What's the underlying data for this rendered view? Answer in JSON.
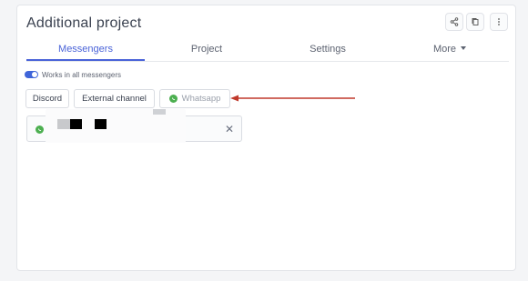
{
  "card": {
    "title": "Additional project"
  },
  "toolbar": {
    "icons": [
      "share-icon",
      "copy-icon",
      "more-vertical-icon"
    ]
  },
  "tabs": [
    {
      "label": "Messengers",
      "active": true
    },
    {
      "label": "Project",
      "active": false
    },
    {
      "label": "Settings",
      "active": false
    },
    {
      "label": "More",
      "active": false,
      "dropdown": true
    }
  ],
  "toggle": {
    "label": "Works in all messengers",
    "on": true
  },
  "channels": [
    {
      "label": "Discord"
    },
    {
      "label": "External channel"
    },
    {
      "label": "Whatsapp",
      "icon": "whatsapp-icon"
    }
  ],
  "account": {
    "icon": "whatsapp-icon",
    "remove_icon": "close-icon",
    "remove_label": "✕"
  },
  "colors": {
    "accent": "#4a63d8",
    "toggle": "#3f65d9",
    "whatsapp": "#4caf50",
    "arrow": "#c0392b"
  }
}
